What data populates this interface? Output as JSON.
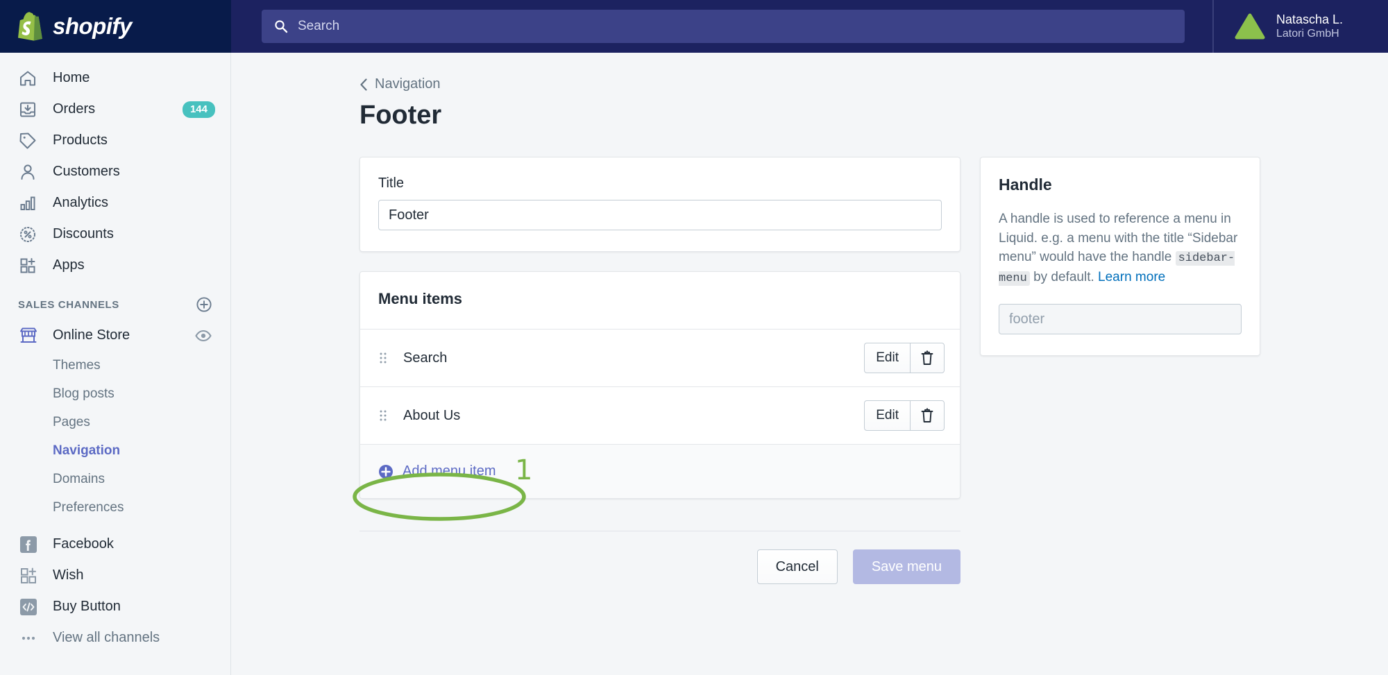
{
  "topbar": {
    "brand": "shopify",
    "search": {
      "placeholder": "Search",
      "icon": "search-icon"
    },
    "user": {
      "name": "Natascha L.",
      "org": "Latori GmbH",
      "avatar": "triangle-avatar"
    }
  },
  "sidebar": {
    "nav": [
      {
        "label": "Home",
        "icon": "home-icon",
        "badge": ""
      },
      {
        "label": "Orders",
        "icon": "orders-inbox-icon",
        "badge": "144"
      },
      {
        "label": "Products",
        "icon": "products-tag-icon",
        "badge": ""
      },
      {
        "label": "Customers",
        "icon": "customers-person-icon",
        "badge": ""
      },
      {
        "label": "Analytics",
        "icon": "analytics-bars-icon",
        "badge": ""
      },
      {
        "label": "Discounts",
        "icon": "discounts-percent-icon",
        "badge": ""
      },
      {
        "label": "Apps",
        "icon": "apps-grid-plus-icon",
        "badge": ""
      }
    ],
    "sales_channels_title": "SALES CHANNELS",
    "add_channel_icon": "plus-circle-icon",
    "online_store": {
      "label": "Online Store",
      "icon": "storefront-icon",
      "view_icon": "eye-icon"
    },
    "online_store_subitems": [
      {
        "label": "Themes",
        "active": false
      },
      {
        "label": "Blog posts",
        "active": false
      },
      {
        "label": "Pages",
        "active": false
      },
      {
        "label": "Navigation",
        "active": true
      },
      {
        "label": "Domains",
        "active": false
      },
      {
        "label": "Preferences",
        "active": false
      }
    ],
    "channels": [
      {
        "label": "Facebook",
        "icon": "facebook-icon",
        "muted": false
      },
      {
        "label": "Wish",
        "icon": "wish-grid-icon",
        "muted": false
      },
      {
        "label": "Buy Button",
        "icon": "buy-button-code-icon",
        "muted": false
      },
      {
        "label": "View all channels",
        "icon": "ellipsis-icon",
        "muted": true
      }
    ]
  },
  "page": {
    "breadcrumb": "Navigation",
    "breadcrumb_icon": "chevron-left-icon",
    "title": "Footer"
  },
  "title_card": {
    "label": "Title",
    "value": "Footer"
  },
  "menu_items_card": {
    "header": "Menu items",
    "rows": [
      {
        "label": "Search",
        "drag_icon": "drag-handle-icon",
        "edit_label": "Edit",
        "delete_icon": "trash-icon"
      },
      {
        "label": "About Us",
        "drag_icon": "drag-handle-icon",
        "edit_label": "Edit",
        "delete_icon": "trash-icon"
      }
    ],
    "add_label": "Add menu item",
    "add_icon": "plus-circle-filled-icon"
  },
  "handle_card": {
    "title": "Handle",
    "desc_part1": "A handle is used to reference a menu in Liquid. e.g. a menu with the title “Sidebar menu” would have the handle ",
    "code": "sidebar-menu",
    "desc_part2": " by default. ",
    "learn_more": "Learn more",
    "input_value": "footer"
  },
  "footer_actions": {
    "cancel_label": "Cancel",
    "save_label": "Save menu"
  },
  "annotation": {
    "number": "1",
    "color": "#7ab547",
    "target": "add-menu-item-link"
  },
  "colors": {
    "topbar_bg": "#1c2260",
    "logo_bg": "#081b4a",
    "brand_green": "#95bf47",
    "accent_purple": "#5c6ac4",
    "badge_teal": "#47c1bf",
    "link_blue": "#006fbb",
    "page_bg": "#f4f6f8",
    "annotation_green": "#7ab547"
  }
}
